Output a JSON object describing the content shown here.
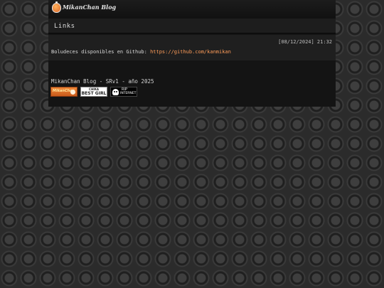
{
  "header": {
    "site_name": "MikanChan Blog",
    "logo_icon": "mikan-orange-icon"
  },
  "nav": {
    "links_label": "Links"
  },
  "post": {
    "date": "[08/12/2024] 21:32",
    "text": "Boludeces disponibles en Github: ",
    "link": "https://github.com/kanmikan"
  },
  "footer": {
    "text": "MikanChan Blog - SRv1 - año 2025",
    "badges": {
      "mikanchan": "MikanChan",
      "chika_top": "CHIKA",
      "chika_bottom": "BEST GIRL",
      "rip_top": "RIP",
      "rip_bottom": "INTERNET"
    }
  },
  "colors": {
    "link": "#ff9d5a",
    "panel": "#141414",
    "background": "#2b2b2b"
  }
}
